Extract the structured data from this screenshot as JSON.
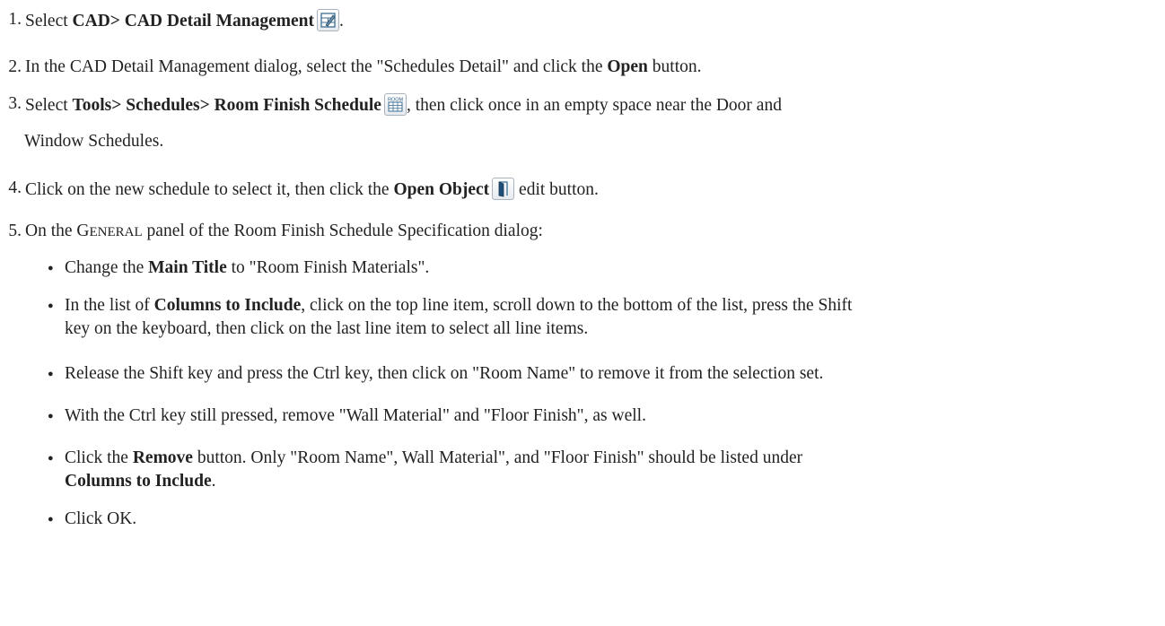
{
  "steps": [
    {
      "num": "1.",
      "a": "Select ",
      "b": "CAD> CAD Detail Management",
      "c": ".",
      "icon": "cad-detail-management-icon"
    },
    {
      "num": "2.",
      "a": "In the CAD Detail Management dialog, select the \"Schedules Detail\" and click the ",
      "b": "Open",
      "c": " button."
    },
    {
      "num": "3.",
      "a": "Select ",
      "b": "Tools> Schedules> Room Finish Schedule",
      "c": ", then click once in an empty space near the Door and",
      "d": "Window Schedules.",
      "icon": "room-finish-schedule-icon",
      "icon_text": "ROOM"
    },
    {
      "num": "4.",
      "a": "Click on the new schedule to select it, then click the ",
      "b": "Open Object",
      "c": " edit button.",
      "icon": "open-object-icon"
    },
    {
      "num": "5.",
      "a": "On the ",
      "sc1": "G",
      "sc2": "ENERAL",
      "c": " panel of the Room Finish Schedule Specification dialog:"
    }
  ],
  "bullets": [
    {
      "a": "Change the ",
      "b": "Main Title",
      "c": " to \"Room Finish Materials\"."
    },
    {
      "a": "In the list of ",
      "b": "Columns to Include",
      "c": ", click on the top line item, scroll down to the bottom of the list, press the Shift",
      "d": "key on the keyboard, then click on the last line item to select all line items."
    },
    {
      "a": "Release the Shift key and press the Ctrl key, then click on \"Room Name\" to remove it from the selection set."
    },
    {
      "a": "With the Ctrl key still pressed, remove \"Wall Material\" and \"Floor Finish\", as well."
    },
    {
      "a": "Click the ",
      "b": "Remove",
      "c": " button. Only \"Room Name\", Wall Material\", and \"Floor Finish\" should be listed under",
      "d": "Columns to Include",
      "e": "."
    },
    {
      "a": "Click OK."
    }
  ],
  "bullet_char": "●"
}
